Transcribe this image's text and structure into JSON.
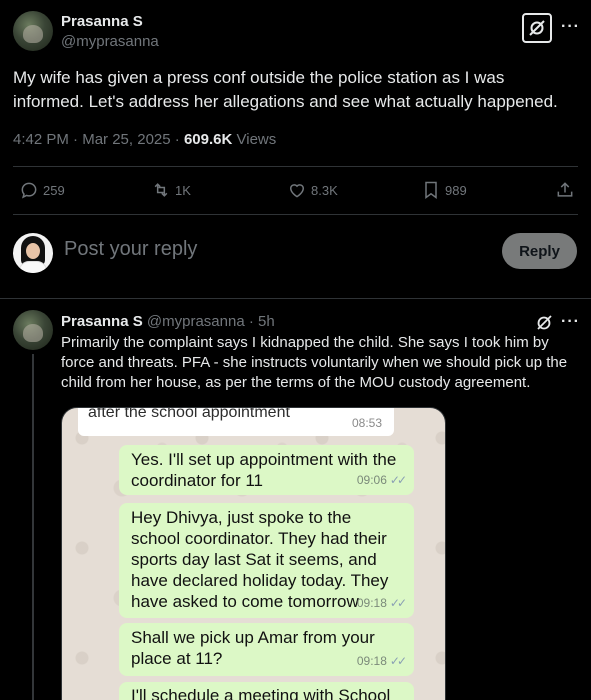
{
  "main_post": {
    "author_name": "Prasanna S",
    "author_handle": "@myprasanna",
    "text": "My wife has given a press conf outside the police station as I was informed. Let's address her allegations and see what actually happened.",
    "time": "4:42 PM",
    "date": "Mar 25, 2025",
    "views_count": "609.6K",
    "views_label": "Views",
    "more_icon": "···"
  },
  "actions": {
    "replies": "259",
    "reposts": "1K",
    "likes": "8.3K",
    "bookmarks": "989"
  },
  "reply_box": {
    "placeholder": "Post your reply",
    "button_label": "Reply"
  },
  "reply_post": {
    "author_name": "Prasanna S",
    "author_handle": "@myprasanna",
    "age": "5h",
    "text": "Primarily the complaint says I kidnapped the child. She says I took him by force and threats. PFA - she instructs voluntarily when we should pick up the child from her house, as per the terms of the MOU custody agreement.",
    "more_icon": "···"
  },
  "chat_screenshot": {
    "quoted_text": "after the school appointment",
    "quoted_time": "08:53",
    "messages": [
      {
        "text": "Yes. I'll set up appointment with the coordinator for 11",
        "time": "09:06"
      },
      {
        "text": "Hey Dhivya, just spoke to the school coordinator.  They had their sports day last Sat it seems, and have declared holiday today. They have asked to come tomorrow",
        "time": "09:18"
      },
      {
        "text": "Shall we pick up Amar from your place at 11?",
        "time": "09:18"
      },
      {
        "text": "I'll schedule a meeting with School",
        "time": ""
      }
    ],
    "ticks": "✓✓"
  },
  "colors": {
    "background": "#000000",
    "text_primary": "#e7e9ea",
    "text_secondary": "#71767b",
    "divider": "#2f3336",
    "reply_button": "#787a7a",
    "bubble": "#dcf8c6"
  }
}
